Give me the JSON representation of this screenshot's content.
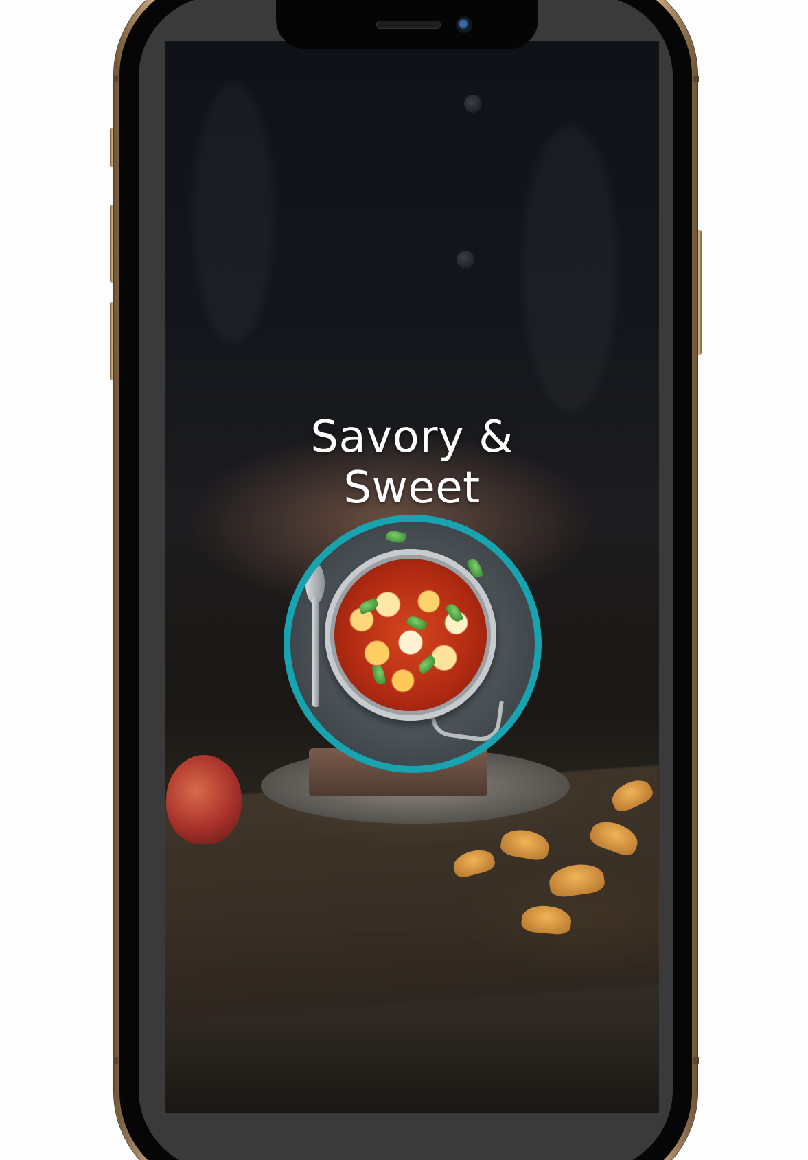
{
  "app": {
    "title_line1": "Savory &",
    "title_line2": "Sweet"
  },
  "colors": {
    "accent_ring": "#17a3b0",
    "title_text": "#ffffff",
    "phone_frame": "#c9a57c"
  },
  "icons": {
    "hero_image": "food-dish-image",
    "background_image": "chef-background-image"
  }
}
